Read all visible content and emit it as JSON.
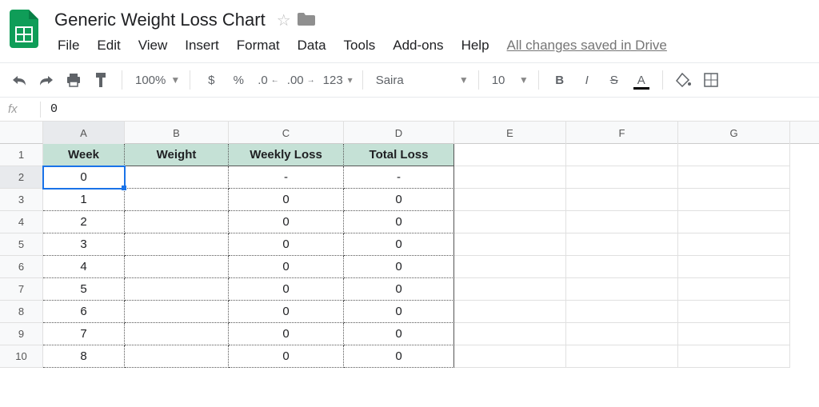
{
  "doc_title": "Generic Weight Loss Chart",
  "menubar": [
    "File",
    "Edit",
    "View",
    "Insert",
    "Format",
    "Data",
    "Tools",
    "Add-ons",
    "Help"
  ],
  "save_status": "All changes saved in Drive",
  "toolbar": {
    "zoom": "100%",
    "font": "Saira",
    "font_size": "10",
    "decrease_dec": ".0",
    "increase_dec": ".00",
    "more_formats": "123"
  },
  "formula_bar": {
    "fx": "fx",
    "value": "0"
  },
  "columns": [
    "A",
    "B",
    "C",
    "D",
    "E",
    "F",
    "G"
  ],
  "rows": [
    "1",
    "2",
    "3",
    "4",
    "5",
    "6",
    "7",
    "8",
    "9",
    "10"
  ],
  "table": {
    "headers": [
      "Week",
      "Weight",
      "Weekly Loss",
      "Total Loss"
    ],
    "data": [
      {
        "week": "0",
        "weight": "",
        "weekly": "-",
        "total": "-"
      },
      {
        "week": "1",
        "weight": "",
        "weekly": "0",
        "total": "0"
      },
      {
        "week": "2",
        "weight": "",
        "weekly": "0",
        "total": "0"
      },
      {
        "week": "3",
        "weight": "",
        "weekly": "0",
        "total": "0"
      },
      {
        "week": "4",
        "weight": "",
        "weekly": "0",
        "total": "0"
      },
      {
        "week": "5",
        "weight": "",
        "weekly": "0",
        "total": "0"
      },
      {
        "week": "6",
        "weight": "",
        "weekly": "0",
        "total": "0"
      },
      {
        "week": "7",
        "weight": "",
        "weekly": "0",
        "total": "0"
      },
      {
        "week": "8",
        "weight": "",
        "weekly": "0",
        "total": "0"
      }
    ]
  },
  "selected_cell": {
    "row": 2,
    "col": "A"
  }
}
